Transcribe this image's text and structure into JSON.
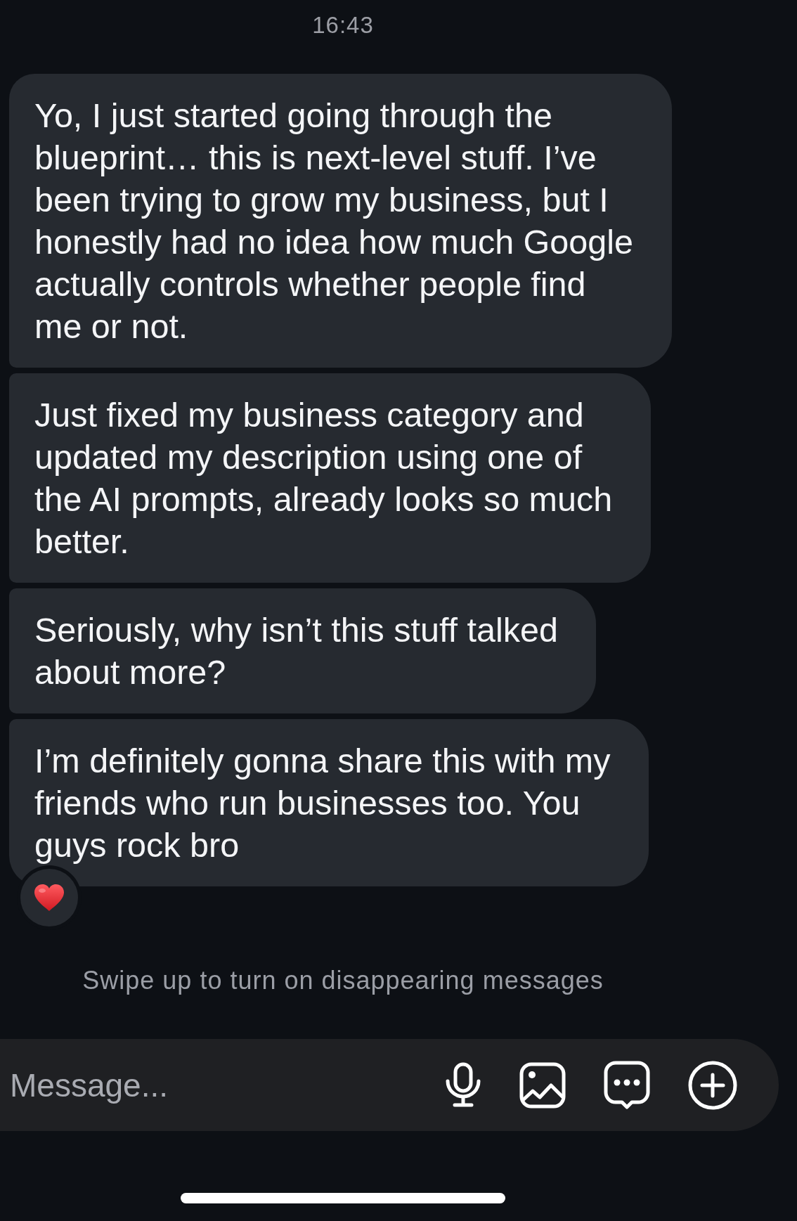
{
  "timestamp": "16:43",
  "messages": [
    {
      "text": "Yo, I just started going through the blueprint… this is next-level stuff. I’ve been trying to grow my business, but I honestly had no idea how much Google actually controls whether people find me or not.",
      "reacted": false
    },
    {
      "text": "Just fixed my business category and updated my description using one of the AI prompts, already looks so much better.",
      "reacted": false
    },
    {
      "text": "Seriously, why isn’t this stuff talked about more?",
      "reacted": false
    },
    {
      "text": "I’m definitely gonna share this with my friends who run businesses too. You guys rock bro",
      "reacted": true
    }
  ],
  "hint": "Swipe up to turn on disappearing messages",
  "composer": {
    "placeholder": "Message..."
  }
}
